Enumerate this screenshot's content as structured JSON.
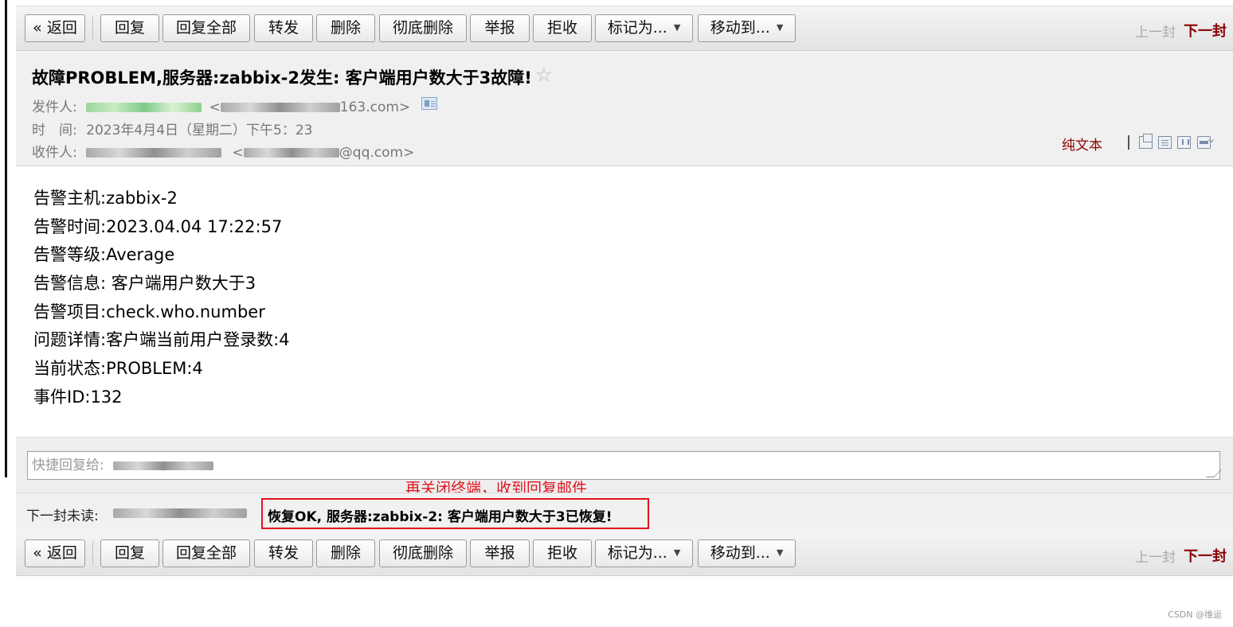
{
  "toolbar": {
    "back": "« 返回",
    "reply": "回复",
    "reply_all": "回复全部",
    "forward": "转发",
    "delete": "删除",
    "delete_permanently": "彻底删除",
    "report": "举报",
    "reject": "拒收",
    "mark_as": "标记为...",
    "move_to": "移动到...",
    "prev": "上一封",
    "next": "下一封"
  },
  "email": {
    "subject": "故障PROBLEM,服务器:zabbix-2发生: 客户端用户数大于3故障!",
    "from_label": "发件人:",
    "from_addr_suffix": "163.com>",
    "time_label": "时　间:",
    "time_value": "2023年4月4日（星期二）下午5：23",
    "to_label": "收件人:",
    "to_addr_suffix": "@qq.com>",
    "plain_text": "纯文本",
    "body_lines": [
      "告警主机:zabbix-2",
      "告警时间:2023.04.04 17:22:57",
      "告警等级:Average",
      "告警信息: 客户端用户数大于3",
      "告警项目:check.who.number",
      "问题详情:客户端当前用户登录数:4",
      "当前状态:PROBLEM:4",
      "事件ID:132"
    ]
  },
  "quick_reply": {
    "placeholder": "快捷回复给:"
  },
  "annotation": "再关闭终端，收到回复邮件",
  "next_unread": {
    "label": "下一封未读:",
    "subject": "恢复OK, 服务器:zabbix-2: 客户端用户数大于3已恢复!"
  },
  "icons": {
    "star": "star-icon",
    "contact": "contact-card-icon",
    "new_window": "new-window-icon",
    "print": "print-icon",
    "expand": "chevron-down-icon"
  },
  "colors": {
    "accent": "#8b0000",
    "annotation": "#e0141e"
  },
  "watermark": "CSDN @维运"
}
